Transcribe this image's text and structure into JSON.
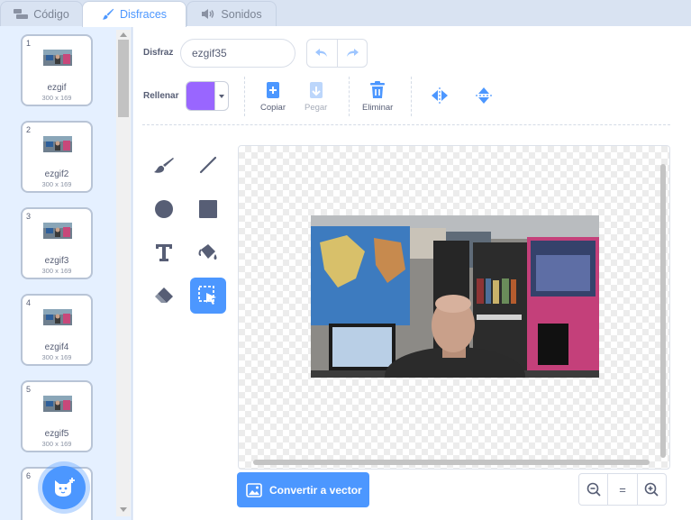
{
  "tabs": [
    {
      "label": "Código",
      "icon": "code-blocks-icon"
    },
    {
      "label": "Disfraces",
      "icon": "paintbrush-icon",
      "active": true
    },
    {
      "label": "Sonidos",
      "icon": "speaker-icon"
    }
  ],
  "costumes": [
    {
      "number": "1",
      "name": "ezgif",
      "size": "300 x 169"
    },
    {
      "number": "2",
      "name": "ezgif2",
      "size": "300 x 169"
    },
    {
      "number": "3",
      "name": "ezgif3",
      "size": "300 x 169"
    },
    {
      "number": "4",
      "name": "ezgif4",
      "size": "300 x 169"
    },
    {
      "number": "5",
      "name": "ezgif5",
      "size": "300 x 169"
    },
    {
      "number": "6",
      "name": "",
      "size": ""
    }
  ],
  "editor": {
    "costume_label": "Disfraz",
    "costume_name": "ezgif35",
    "fill_label": "Rellenar",
    "fill_color": "#9966ff",
    "copy_label": "Copiar",
    "paste_label": "Pegar",
    "delete_label": "Eliminar",
    "convert_label": "Convertir a vector",
    "zoom_reset_label": "="
  },
  "colors": {
    "accent": "#4c97ff",
    "text": "#575e75",
    "delete": "#4c97ff"
  }
}
